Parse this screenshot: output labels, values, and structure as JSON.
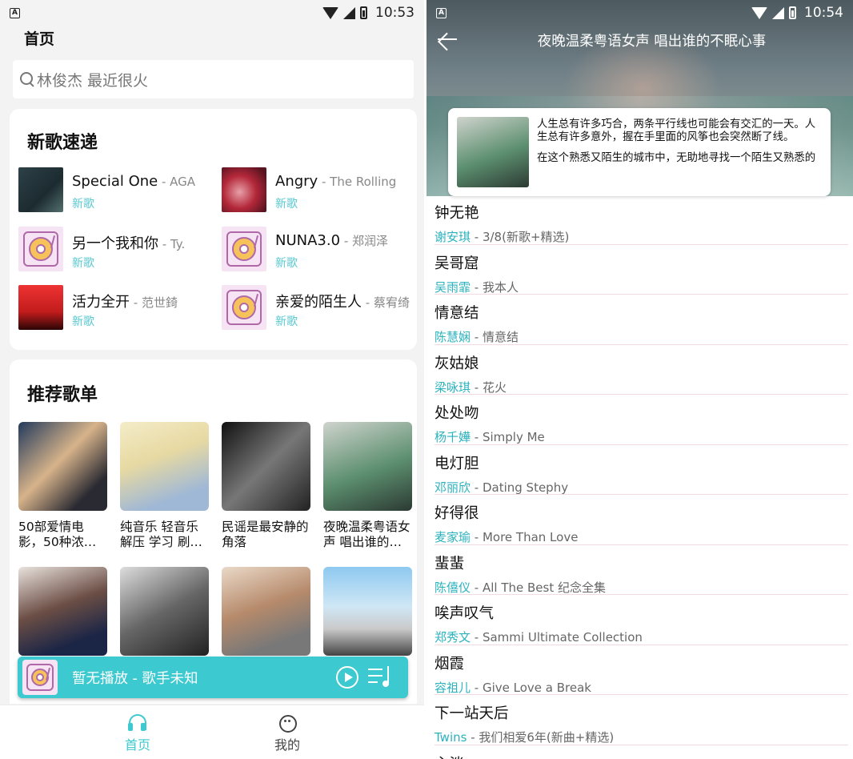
{
  "status_left": {
    "time": "10:53"
  },
  "status_right": {
    "time": "10:54"
  },
  "home": {
    "title": "首页",
    "search_placeholder": "林俊杰 最近很火",
    "new_songs": {
      "title": "新歌速递",
      "items": [
        {
          "title": "Special One",
          "artist": " - AGA",
          "tag": "新歌",
          "cover": "album-cover"
        },
        {
          "title": "Angry",
          "artist": " - The Rolling",
          "tag": "新歌",
          "cover": "album-cover"
        },
        {
          "title": "另一个我和你",
          "artist": " - Ty.",
          "tag": "新歌",
          "cover": "vinyl-placeholder-icon"
        },
        {
          "title": "NUNA3.0",
          "artist": " - 郑润泽",
          "tag": "新歌",
          "cover": "vinyl-placeholder-icon"
        },
        {
          "title": "活力全开",
          "artist": " - 范世錡",
          "tag": "新歌",
          "cover": "album-cover"
        },
        {
          "title": "亲爱的陌生人",
          "artist": " - 蔡宥绮",
          "tag": "新歌",
          "cover": "vinyl-placeholder-icon"
        }
      ]
    },
    "playlists": {
      "title": "推荐歌单",
      "items": [
        {
          "name": "50部爱情电影，50种浓情蜜意"
        },
        {
          "name": "纯音乐 轻音乐 解压 学习 刷题…"
        },
        {
          "name": "民谣是最安静的角落"
        },
        {
          "name": "夜晚温柔粤语女声 唱出谁的不…"
        },
        {
          "name": ""
        },
        {
          "name": ""
        },
        {
          "name": ""
        },
        {
          "name": ""
        }
      ]
    },
    "player": {
      "now_playing": "暂无播放 - 歌手未知"
    },
    "tabs": [
      {
        "label": "首页",
        "icon": "headphones-icon",
        "active": true
      },
      {
        "label": "我的",
        "icon": "robot-face-icon",
        "active": false
      }
    ]
  },
  "detail": {
    "title": "夜晚温柔粤语女声 唱出谁的不眠心事",
    "intro": [
      "人生总有许多巧合，两条平行线也可能会有交汇的一天。人生总有许多意外，握在手里面的风筝也会突然断了线。",
      "在这个熟悉又陌生的城市中，无助地寻找一个陌生又熟悉的"
    ],
    "tracks": [
      {
        "name": "钟无艳",
        "singer": "谢安琪",
        "album": " - 3/8(新歌+精选)"
      },
      {
        "name": "吴哥窟",
        "singer": "吴雨霏",
        "album": " - 我本人"
      },
      {
        "name": "情意结",
        "singer": "陈慧娴",
        "album": " - 情意结"
      },
      {
        "name": "灰姑娘",
        "singer": "梁咏琪",
        "album": " - 花火"
      },
      {
        "name": "处处吻",
        "singer": "杨千嬅",
        "album": " - Simply Me"
      },
      {
        "name": "电灯胆",
        "singer": "邓丽欣",
        "album": " - Dating Stephy"
      },
      {
        "name": "好得很",
        "singer": "麦家瑜",
        "album": " - More Than Love"
      },
      {
        "name": "蜚蜚",
        "singer": "陈僖仪",
        "album": " - All The Best 纪念全集"
      },
      {
        "name": "唉声叹气",
        "singer": "郑秀文",
        "album": " - Sammi Ultimate Collection"
      },
      {
        "name": "烟霞",
        "singer": "容祖儿",
        "album": " - Give Love a Break"
      },
      {
        "name": "下一站天后",
        "singer": "Twins",
        "album": " - 我们相爱6年(新曲+精选)"
      },
      {
        "name": "心淡",
        "singer": "",
        "album": ""
      }
    ]
  },
  "colors": {
    "accent": "#3cc9cf",
    "tag": "#58c8d0",
    "singer": "#2bb2bd"
  }
}
